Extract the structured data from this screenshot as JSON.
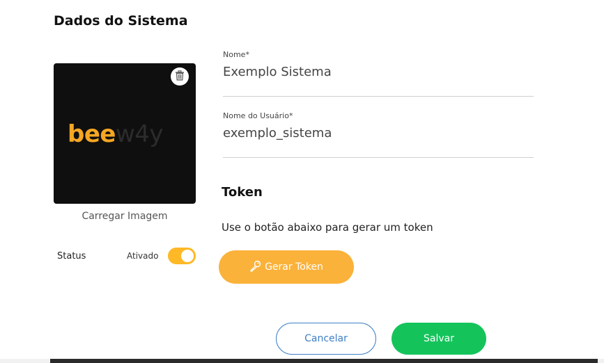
{
  "section": {
    "title": "Dados do Sistema"
  },
  "image": {
    "logo_part1": "bee",
    "logo_part2": "w4y",
    "upload_label": "Carregar Imagem"
  },
  "status": {
    "label": "Status",
    "value": "Ativado",
    "enabled": true
  },
  "fields": {
    "nome": {
      "label": "Nome*",
      "value": "Exemplo Sistema"
    },
    "usuario": {
      "label": "Nome do Usuário*",
      "value": "exemplo_sistema"
    }
  },
  "token": {
    "title": "Token",
    "description": "Use o botão abaixo para gerar um token",
    "button_label": "Gerar Token"
  },
  "actions": {
    "cancel_label": "Cancelar",
    "save_label": "Salvar"
  },
  "colors": {
    "accent": "#FBB23A",
    "save": "#14C45B",
    "cancel": "#3d7fc7"
  },
  "icons": {
    "delete": "trash-icon",
    "token": "key-icon"
  }
}
